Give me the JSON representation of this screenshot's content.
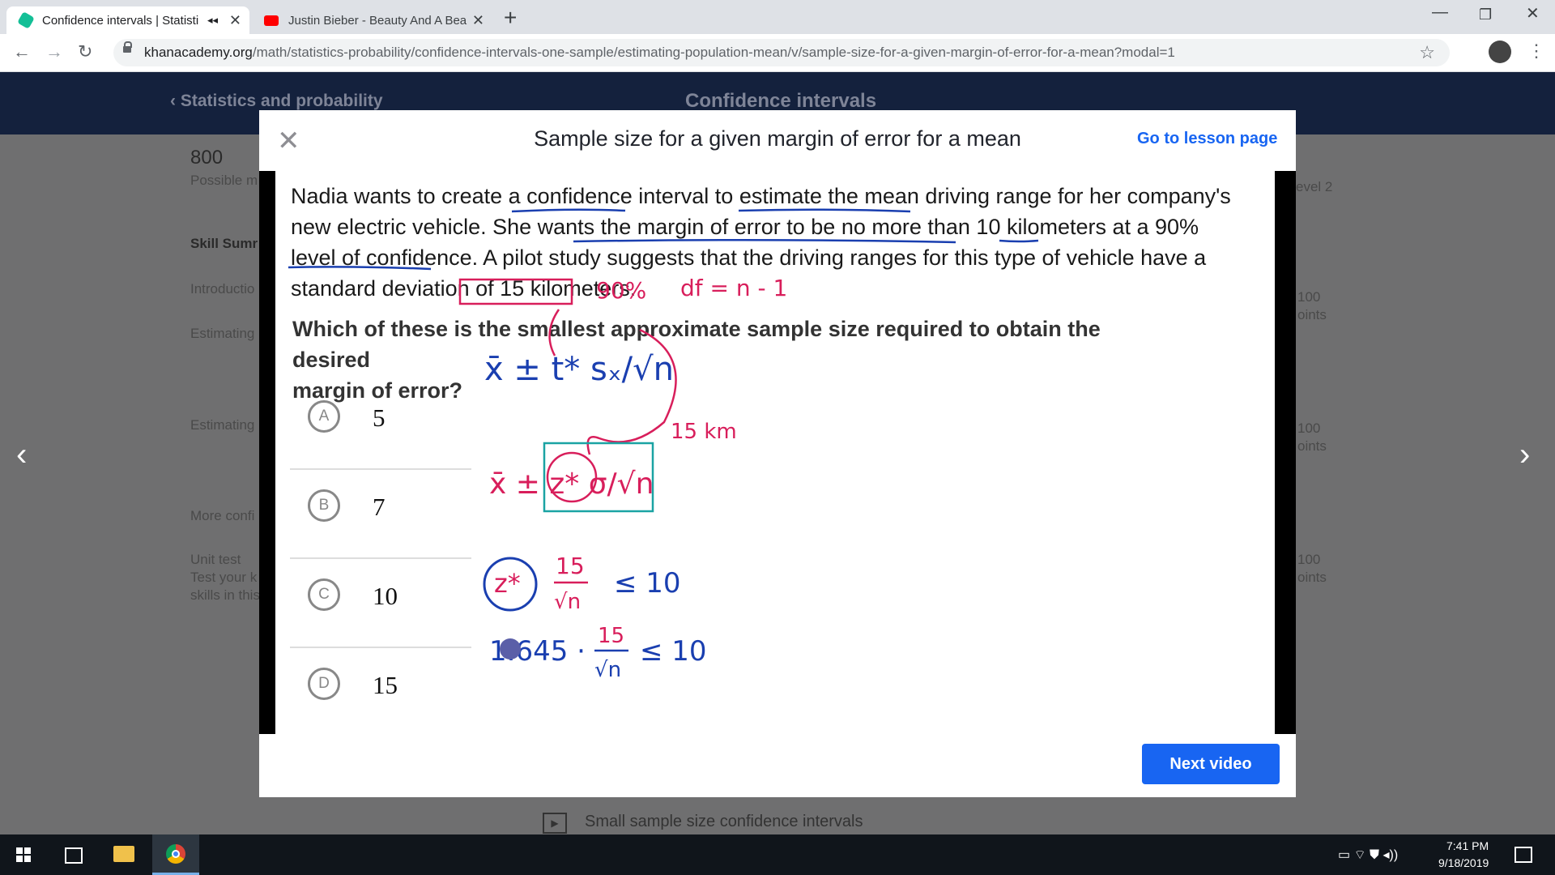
{
  "tabs": [
    {
      "title": "Confidence intervals | Statisti",
      "active": true
    },
    {
      "title": "Justin Bieber - Beauty And A Bea",
      "active": false
    }
  ],
  "address": {
    "domain": "khanacademy.org",
    "path": "/math/statistics-probability/confidence-intervals-one-sample/estimating-population-mean/v/sample-size-for-a-given-margin-of-error-for-a-mean?modal=1"
  },
  "background": {
    "breadcrumb": "Statistics and probability",
    "section": "Confidence intervals",
    "points": "800",
    "points_label": "Possible m",
    "skill_summary": "Skill Sumr",
    "sidebar": [
      "Introductio",
      "Estimating",
      "Estimating",
      "More confi",
      "Unit test",
      "Test your k",
      "skills in this"
    ],
    "right_labels": [
      "evel 2",
      "100",
      "oints",
      "100",
      "oints",
      "100",
      "oints"
    ],
    "bottom_item": "Small sample size confidence intervals"
  },
  "modal": {
    "title": "Sample size for a given margin of error for a mean",
    "lesson_link": "Go to lesson page",
    "next_button": "Next video"
  },
  "problem": {
    "question_lines": [
      "Nadia wants to create a confidence interval to estimate the mean driving range for her company's",
      "new electric vehicle. She wants the margin of error to be no more than 10 kilometers at a 90%",
      "level of confidence. A pilot study suggests that the driving ranges for this type of vehicle have a",
      "standard deviation of 15 kilometers."
    ],
    "prompt_lines": [
      "Which of these is the smallest approximate sample size required to obtain the desired",
      "margin of error?"
    ],
    "choices": [
      {
        "letter": "A",
        "value": "5"
      },
      {
        "letter": "B",
        "value": "7"
      },
      {
        "letter": "C",
        "value": "10"
      },
      {
        "letter": "D",
        "value": "15"
      }
    ]
  },
  "annotations": {
    "red": [
      "90%",
      "df = n - 1",
      "15 km"
    ],
    "blue_formula": "x̄ ± t* sₓ/√n",
    "z_formula": "x̄ ± z* σ/√n",
    "ineq1_num": "15",
    "ineq1_den": "√n",
    "ineq1_rhs": "≤ 10",
    "ineq2": "1.645 ·",
    "ineq2_num": "15",
    "ineq2_den": "√n",
    "ineq2_rhs": "≤ 10"
  },
  "taskbar": {
    "time": "7:41 PM",
    "date": "9/18/2019"
  },
  "colors": {
    "accent": "#1865f2",
    "header": "#14213d",
    "ink_blue": "#1a3fb0",
    "ink_red": "#d81e5b",
    "ink_teal": "#1aa3a3"
  }
}
